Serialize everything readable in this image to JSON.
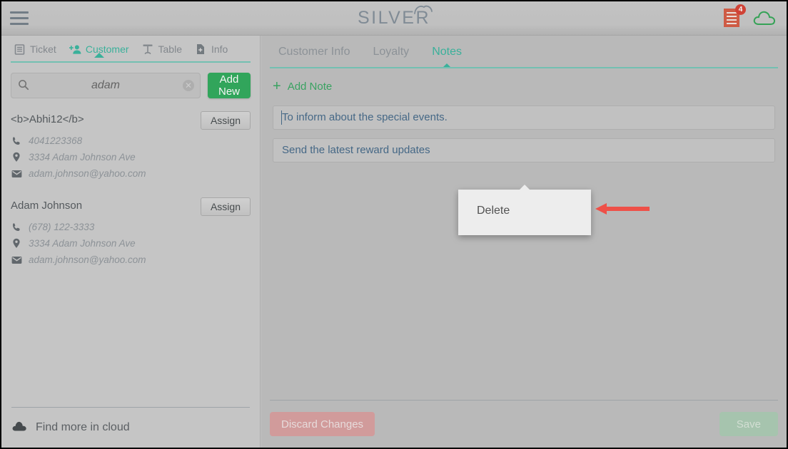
{
  "header": {
    "menu_icon": "hamburger-menu-icon",
    "logo_text": "SILVER",
    "logo_mark": "cloud-arc-icon",
    "receipt_icon": "receipt-icon",
    "receipt_badge": "4",
    "cloud_icon": "cloud-outline-icon",
    "accent_red": "#d6382b",
    "accent_green": "#25a654",
    "accent_teal": "#2fb39a"
  },
  "left": {
    "tabs": [
      {
        "label": "Ticket",
        "icon": "ticket-icon",
        "active": false
      },
      {
        "label": "Customer",
        "icon": "add-person-icon",
        "active": true
      },
      {
        "label": "Table",
        "icon": "table-icon",
        "active": false
      },
      {
        "label": "Info",
        "icon": "info-file-icon",
        "active": false
      }
    ],
    "search": {
      "value": "adam",
      "placeholder": "Search",
      "icon": "search-icon",
      "clear_icon": "clear-circle-icon"
    },
    "add_new_label": "Add New",
    "assign_label": "Assign",
    "customers": [
      {
        "name": "<b>Abhi12</b>",
        "phone": "4041223368",
        "address": "3334 Adam Johnson Ave",
        "email": "adam.johnson@yahoo.com"
      },
      {
        "name": "Adam Johnson",
        "phone": "(678) 122-3333",
        "address": "3334 Adam Johnson Ave",
        "email": "adam.johnson@yahoo.com"
      }
    ],
    "footer": {
      "label": "Find more in cloud",
      "icon": "cloud-filled-icon"
    }
  },
  "right": {
    "tabs": [
      {
        "label": "Customer Info",
        "active": false
      },
      {
        "label": "Loyalty",
        "active": false
      },
      {
        "label": "Notes",
        "active": true
      }
    ],
    "add_note_label": "Add Note",
    "add_note_icon": "plus-icon",
    "notes": [
      {
        "text": "To inform about the special events.",
        "has_caret": true
      },
      {
        "text": "Send the latest reward updates",
        "has_caret": false
      }
    ],
    "popup": {
      "delete_label": "Delete",
      "annotation_icon": "red-left-arrow-icon"
    },
    "footer": {
      "discard_label": "Discard Changes",
      "save_label": "Save"
    }
  }
}
